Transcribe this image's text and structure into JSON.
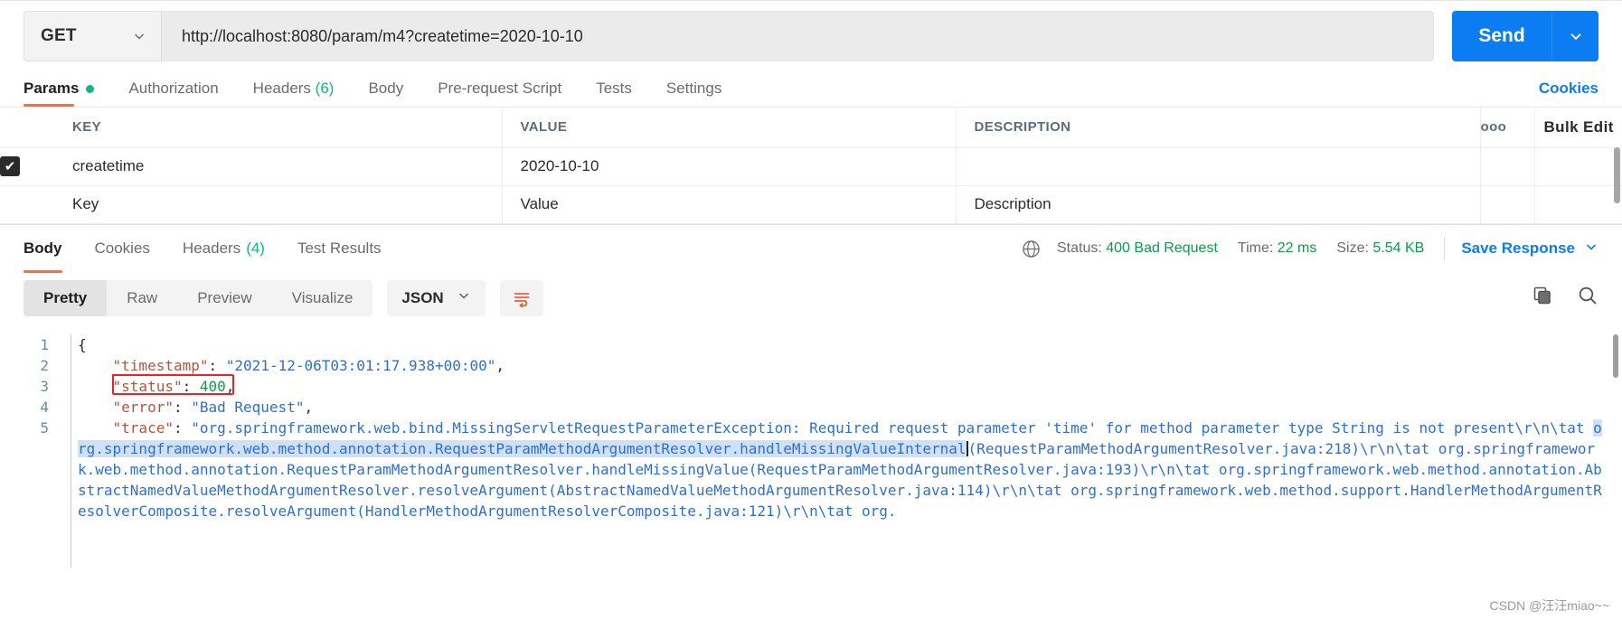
{
  "request": {
    "method": "GET",
    "method_caret": "chevron-down",
    "url": "http://localhost:8080/param/m4?createtime=2020-10-10",
    "send_label": "Send",
    "send_caret": "chevron-down"
  },
  "request_tabs": [
    {
      "label": "Params",
      "badge": "dot",
      "active": true
    },
    {
      "label": "Authorization",
      "badge": "",
      "active": false
    },
    {
      "label": "Headers",
      "badge": "(6)",
      "active": false
    },
    {
      "label": "Body",
      "badge": "",
      "active": false
    },
    {
      "label": "Pre-request Script",
      "badge": "",
      "active": false
    },
    {
      "label": "Tests",
      "badge": "",
      "active": false
    },
    {
      "label": "Settings",
      "badge": "",
      "active": false
    }
  ],
  "cookies_link": "Cookies",
  "params_table": {
    "headers": [
      "KEY",
      "VALUE",
      "DESCRIPTION"
    ],
    "dots_label": "ooo",
    "bulk_edit_label": "Bulk Edit",
    "rows": [
      {
        "checked": true,
        "key": "createtime",
        "value": "2020-10-10",
        "description": ""
      }
    ],
    "empty_row": {
      "key": "Key",
      "value": "Value",
      "description": "Description"
    },
    "check_glyph": "✔"
  },
  "response_tabs": [
    {
      "label": "Body",
      "badge": "",
      "active": true
    },
    {
      "label": "Cookies",
      "badge": "",
      "active": false
    },
    {
      "label": "Headers",
      "badge": "(4)",
      "active": false
    },
    {
      "label": "Test Results",
      "badge": "",
      "active": false
    }
  ],
  "response_status": {
    "globe_icon": "globe-icon",
    "status_label": "Status:",
    "status_value": "400 Bad Request",
    "time_label": "Time:",
    "time_value": "22 ms",
    "size_label": "Size:",
    "size_value": "5.54 KB",
    "save_response": "Save Response",
    "save_caret": "chevron-down"
  },
  "body_toolbar": {
    "views": [
      {
        "label": "Pretty",
        "active": true
      },
      {
        "label": "Raw",
        "active": false
      },
      {
        "label": "Preview",
        "active": false
      },
      {
        "label": "Visualize",
        "active": false
      }
    ],
    "format": "JSON",
    "format_caret": "chevron-down",
    "wrap_icon": "word-wrap-icon",
    "copy_icon": "copy-icon",
    "search_icon": "search-icon"
  },
  "code": {
    "line_numbers": [
      "1",
      "2",
      "3",
      "4",
      "5"
    ],
    "lines": [
      {
        "segments": [
          {
            "t": "{",
            "c": "p"
          }
        ]
      },
      {
        "segments": [
          {
            "t": "    ",
            "c": "p"
          },
          {
            "t": "\"timestamp\"",
            "c": "k"
          },
          {
            "t": ": ",
            "c": "p"
          },
          {
            "t": "\"2021-12-06T03:01:17.938+00:00\"",
            "c": "s"
          },
          {
            "t": ",",
            "c": "p"
          }
        ]
      },
      {
        "segments": [
          {
            "t": "    ",
            "c": "p"
          },
          {
            "t": "\"status\"",
            "c": "k"
          },
          {
            "t": ": ",
            "c": "p"
          },
          {
            "t": "400",
            "c": "n"
          },
          {
            "t": ",",
            "c": "p"
          }
        ]
      },
      {
        "segments": [
          {
            "t": "    ",
            "c": "p"
          },
          {
            "t": "\"error\"",
            "c": "k"
          },
          {
            "t": ": ",
            "c": "p"
          },
          {
            "t": "\"Bad Request\"",
            "c": "s"
          },
          {
            "t": ",",
            "c": "p"
          }
        ]
      },
      {
        "segments": [
          {
            "t": "    ",
            "c": "p"
          },
          {
            "t": "\"trace\"",
            "c": "k"
          },
          {
            "t": ": ",
            "c": "p"
          },
          {
            "t": "\"org.springframework.web.bind.MissingServletRequestParameterException: Required request parameter 'time' for method parameter type String is not present\\r\\n\\tat ",
            "c": "s"
          },
          {
            "t": "org.springframework.web.method.annotation.RequestParamMethodArgumentResolver.handleMissingValueInternal",
            "c": "s sel"
          },
          {
            "t": "(RequestParamMethodArgumentResolver.java:218)\\r\\n\\tat org.springframework.web.method.annotation.RequestParamMethodArgumentResolver.handleMissingValue(RequestParamMethodArgumentResolver.java:193)\\r\\n\\tat org.springframework.web.method.annotation.AbstractNamedValueMethodArgumentResolver.resolveArgument(AbstractNamedValueMethodArgumentResolver.java:114)\\r\\n\\tat org.springframework.web.method.support.HandlerMethodArgumentResolverComposite.resolveArgument(HandlerMethodArgumentResolverComposite.java:121)\\r\\n\\tat org.",
            "c": "s"
          }
        ]
      }
    ],
    "annotations": {
      "status_box": "red-highlight-box-around-status-400",
      "timestamp_underline": "red-underline-under-timestamp-key"
    }
  },
  "watermark": "CSDN @汪汪miao~~"
}
